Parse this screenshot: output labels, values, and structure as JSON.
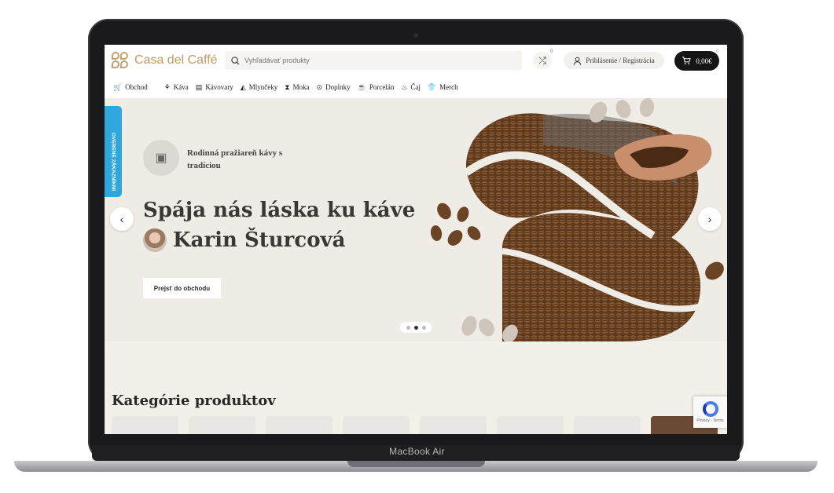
{
  "device": {
    "label": "MacBook Air"
  },
  "header": {
    "logo_text": "Casa del Caffé",
    "search_placeholder": "Vyhľadávať produkty",
    "compare_count": "0",
    "login_label": "Prihlásenie / Registrácia",
    "cart_total": "0,00€",
    "cart_count": "0"
  },
  "nav": {
    "items": [
      {
        "label": "Obchod",
        "icon": "basket-icon"
      },
      {
        "label": "Káva",
        "icon": "beans-icon"
      },
      {
        "label": "Kávovary",
        "icon": "coffee-machine-icon"
      },
      {
        "label": "Mlynčeky",
        "icon": "grinder-icon"
      },
      {
        "label": "Moka",
        "icon": "moka-pot-icon"
      },
      {
        "label": "Doplnky",
        "icon": "accessory-icon"
      },
      {
        "label": "Porcelán",
        "icon": "cup-icon"
      },
      {
        "label": "Čaj",
        "icon": "tea-icon"
      },
      {
        "label": "Merch",
        "icon": "tshirt-icon"
      }
    ]
  },
  "hero": {
    "verified_label": "OVERENÉ ZÁKAZNÍKMI",
    "tagline": "Rodinná pražiareň kávy s tradíciou",
    "headline_line1": "Spája nás láska ku káve",
    "headline_line2": "Karin Šturcová",
    "cta_label": "Prejsť do obchodu",
    "slides_total": 3,
    "active_slide": 2
  },
  "categories": {
    "title": "Kategórie produktov",
    "cards": 8
  },
  "recaptcha": {
    "terms": "Privacy - Terms"
  },
  "colors": {
    "brand": "#c29a63",
    "verified": "#2fa7dd",
    "dark": "#151515"
  }
}
